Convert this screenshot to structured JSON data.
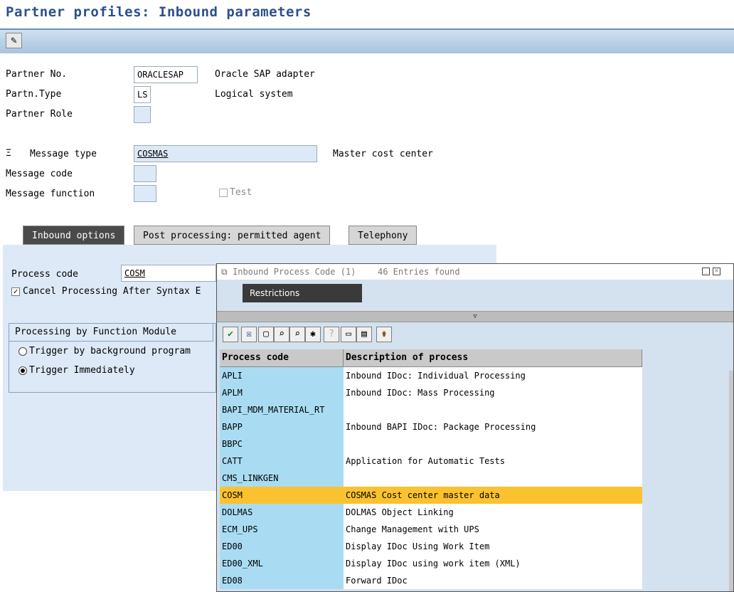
{
  "title": "Partner profiles: Inbound parameters",
  "toolbar": {
    "edit_icon": "pencil-glasses-icon"
  },
  "partner": {
    "no_label": "Partner No.",
    "no_value": "ORACLESAP",
    "no_desc": "Oracle SAP adapter",
    "type_label": "Partn.Type",
    "type_value": "LS",
    "type_desc": "Logical system",
    "role_label": "Partner Role",
    "role_value": ""
  },
  "message": {
    "type_label": "Message type",
    "type_value": "COSMAS",
    "type_desc": "Master cost center",
    "code_label": "Message code",
    "code_value": "",
    "function_label": "Message function",
    "function_value": "",
    "test_label": "Test",
    "test_checked": false
  },
  "tabs": [
    {
      "label": "Inbound options",
      "active": true
    },
    {
      "label": "Post processing: permitted agent",
      "active": false
    },
    {
      "label": "Telephony",
      "active": false
    }
  ],
  "inbound": {
    "process_code_label": "Process code",
    "process_code_value": "COSM",
    "cancel_label": "Cancel Processing After Syntax E",
    "cancel_checked": true,
    "group_title": "Processing by Function Module",
    "radio_background": "Trigger by background program",
    "radio_immediate": "Trigger Immediately",
    "selected_radio": "immediate"
  },
  "popup": {
    "title": "Inbound Process Code (1)",
    "entries_found": "46 Entries found",
    "restrictions_tab": "Restrictions",
    "columns": [
      "Process code",
      "Description of process"
    ],
    "rows": [
      {
        "code": "APLI",
        "desc": "Inbound IDoc: Individual Processing"
      },
      {
        "code": "APLM",
        "desc": "Inbound IDoc: Mass Processing"
      },
      {
        "code": "BAPI_MDM_MATERIAL_RT",
        "desc": ""
      },
      {
        "code": "BAPP",
        "desc": "Inbound BAPI IDoc: Package Processing"
      },
      {
        "code": "BBPC",
        "desc": ""
      },
      {
        "code": "CATT",
        "desc": "Application for Automatic Tests"
      },
      {
        "code": "CMS_LINKGEN",
        "desc": ""
      },
      {
        "code": "COSM",
        "desc": "COSMAS  Cost center master data",
        "selected": true
      },
      {
        "code": "DOLMAS",
        "desc": "DOLMAS Object Linking"
      },
      {
        "code": "ECM_UPS",
        "desc": "Change Management with UPS"
      },
      {
        "code": "ED00",
        "desc": "Display IDoc Using Work Item"
      },
      {
        "code": "ED00_XML",
        "desc": "Display IDoc using work item (XML)"
      },
      {
        "code": "ED08",
        "desc": "Forward IDoc"
      }
    ]
  },
  "colors": {
    "accent": "#2c4f8a",
    "selected_row": "#fbc22f",
    "key_column": "#a9dcf2",
    "panel": "#dde9f6"
  }
}
